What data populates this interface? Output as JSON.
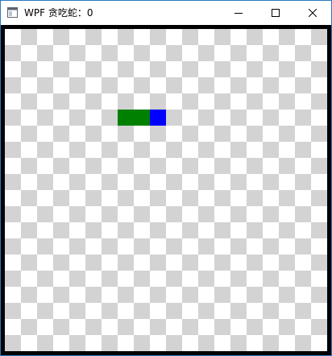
{
  "window": {
    "title": "WPF 贪吃蛇：0",
    "controls": {
      "minimize": "minimize",
      "maximize": "maximize",
      "close": "close"
    }
  },
  "game": {
    "grid": {
      "columns": 20,
      "rows": 20
    },
    "colors": {
      "board_light": "#ffffff",
      "board_dark": "#d3d3d3",
      "border": "#000000",
      "snake_body": "#008000",
      "snake_head": "#0000ff"
    },
    "snake": {
      "head": {
        "col": 9,
        "row": 5
      },
      "body": [
        {
          "col": 7,
          "row": 5
        },
        {
          "col": 8,
          "row": 5
        }
      ]
    }
  }
}
